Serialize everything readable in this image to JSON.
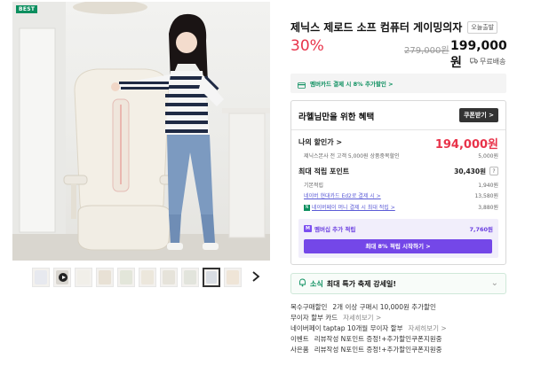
{
  "gallery": {
    "badge": "BEST",
    "thumbnails": [
      "thumb-1",
      "thumb-2",
      "thumb-3",
      "thumb-4",
      "thumb-5",
      "thumb-6",
      "thumb-7",
      "thumb-8",
      "thumb-9",
      "thumb-10"
    ],
    "active_thumbnail_index": 8,
    "next_icon": "chevron-right-icon"
  },
  "product": {
    "title": "제닉스 제로드 소프 컴퓨터 게이밍의자",
    "tag": "오늘출발",
    "discount": "30%",
    "original_price": "279,000원",
    "sale_price": "199,000원",
    "shipping": "무료배송"
  },
  "card_banner": {
    "text": "멤버카드 결제 시 8% 추가할인 >"
  },
  "benefits": {
    "heading": "라헬님만을 위한 혜택",
    "coupon_button": "쿠폰받기 >",
    "my_price_label": "나의 할인가 >",
    "my_price": "194,000원",
    "my_price_note": "제닉스본사 전 고객 5,000원 상품중복할인",
    "my_price_note_value": "5,000원",
    "points_label": "최대 적립 포인트",
    "points_total": "30,430원",
    "help": "?",
    "point_rows": [
      {
        "label": "기본적립",
        "value": "1,940원"
      },
      {
        "label": "네이버 현대카드 Ed2로 결제 시 >",
        "value": "13,580원"
      },
      {
        "label": "네이버페이 머니 결제 시 최대 적립 >",
        "value": "3,880원"
      }
    ],
    "member": {
      "badge": "M",
      "label": "멤버십 추가 적립",
      "points": "7,760원",
      "button": "최대 8% 적립 시작하기 >"
    }
  },
  "event_banner": {
    "prefix": "소식",
    "text": "최대 특가 축제 강세일!"
  },
  "info_rows": [
    {
      "key": "복수구매할인",
      "value": "2개 이상 구매시 10,000원 추가할인",
      "link": ""
    },
    {
      "key": "무이자 할부 카드",
      "value": "",
      "link": "자세히보기 >"
    },
    {
      "key": "네이버페이 taptap 10개월 무이자 할부",
      "value": "",
      "link": "자세히보기 >"
    },
    {
      "key": "이벤트",
      "value": "리뷰작성 N포인트 증정!+추가할인쿠폰지원중",
      "link": ""
    },
    {
      "key": "사은품",
      "value": "리뷰작성 N포인트 증정!+추가할인쿠폰지원중",
      "link": ""
    }
  ]
}
